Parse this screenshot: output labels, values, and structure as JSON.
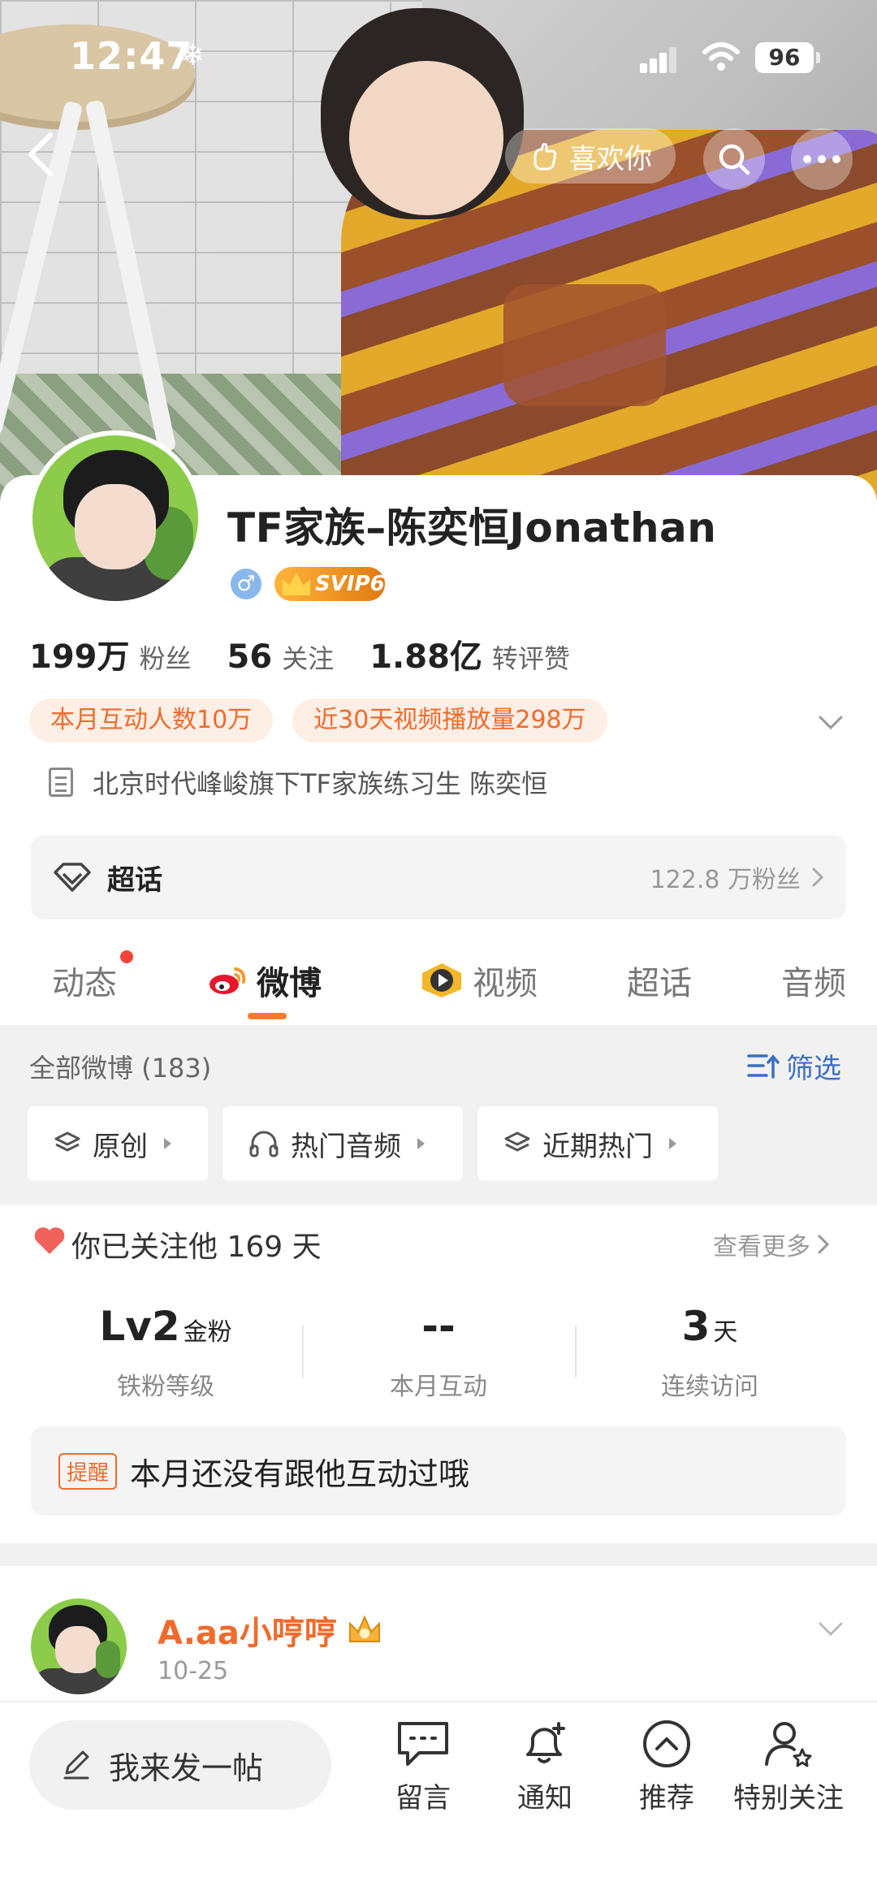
{
  "status_bar": {
    "time": "12:47",
    "battery": "96"
  },
  "header": {
    "like_label": "喜欢你"
  },
  "profile": {
    "name": "TF家族–陈奕恒Jonathan",
    "gender_symbol": "♂",
    "vip_badge": "SVIP6",
    "stats": [
      {
        "value": "199万",
        "label": "粉丝"
      },
      {
        "value": "56",
        "label": "关注"
      },
      {
        "value": "1.88亿",
        "label": "转评赞"
      }
    ],
    "chips": [
      "本月互动人数10万",
      "近30天视频播放量298万"
    ],
    "bio": "北京时代峰峻旗下TF家族练习生 陈奕恒"
  },
  "chaohua": {
    "label": "超话",
    "fans": "122.8 万粉丝"
  },
  "tabs": [
    {
      "label": "动态",
      "active": false
    },
    {
      "label": "微博",
      "active": true
    },
    {
      "label": "视频",
      "active": false
    },
    {
      "label": "超话",
      "active": false
    },
    {
      "label": "音频",
      "active": false
    }
  ],
  "filter": {
    "all_posts": "全部微博 (183)",
    "filter_label": "筛选",
    "buttons": [
      "原创",
      "热门音频",
      "近期热门"
    ]
  },
  "follow_card": {
    "title": "你已关注他 169 天",
    "see_more": "查看更多",
    "stats": [
      {
        "value": "Lv2",
        "unit": "金粉",
        "label": "铁粉等级"
      },
      {
        "value": "--",
        "unit": "",
        "label": "本月互动"
      },
      {
        "value": "3",
        "unit": "天",
        "label": "连续访问"
      }
    ],
    "reminder_tag": "提醒",
    "reminder_text": "本月还没有跟他互动过哦"
  },
  "post": {
    "author": "A.aa小哼哼",
    "date": "10-25"
  },
  "bottom_bar": {
    "compose": "我来发一帖",
    "items": [
      "留言",
      "通知",
      "推荐",
      "特别关注"
    ]
  },
  "colors": {
    "accent": "#ef6b2c",
    "link_blue": "#3b6ec2",
    "tab_indicator": "#ff7a2a"
  }
}
